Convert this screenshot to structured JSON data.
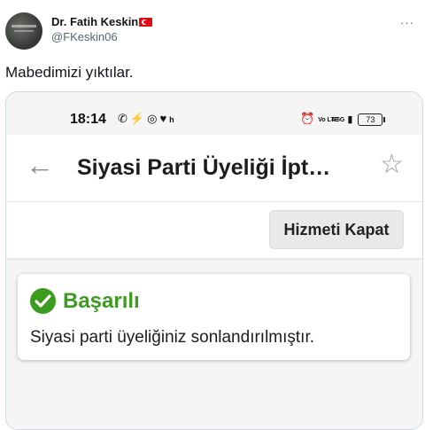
{
  "tweet": {
    "author_name": "Dr. Fatih Keskin",
    "author_handle": "@FKeskin06",
    "text": "Mabedimizi yıktılar.",
    "more_label": "···"
  },
  "phone": {
    "status_bar": {
      "time": "18:14",
      "notification_icons": [
        "whatsapp-icon",
        "messenger-icon",
        "instagram-icon",
        "heart-icon"
      ],
      "carrier_letter": "h",
      "vo_lte_label": "Vo LTE",
      "network_label": "4.5G",
      "battery": "73"
    },
    "page_title": "Siyasi Parti Üyeliği İpt…",
    "close_service_button": "Hizmeti Kapat",
    "result": {
      "title": "Başarılı",
      "message": "Siyasi parti üyeliğiniz sonlandırılmıştır.",
      "status_color": "#3b9c1f"
    }
  }
}
